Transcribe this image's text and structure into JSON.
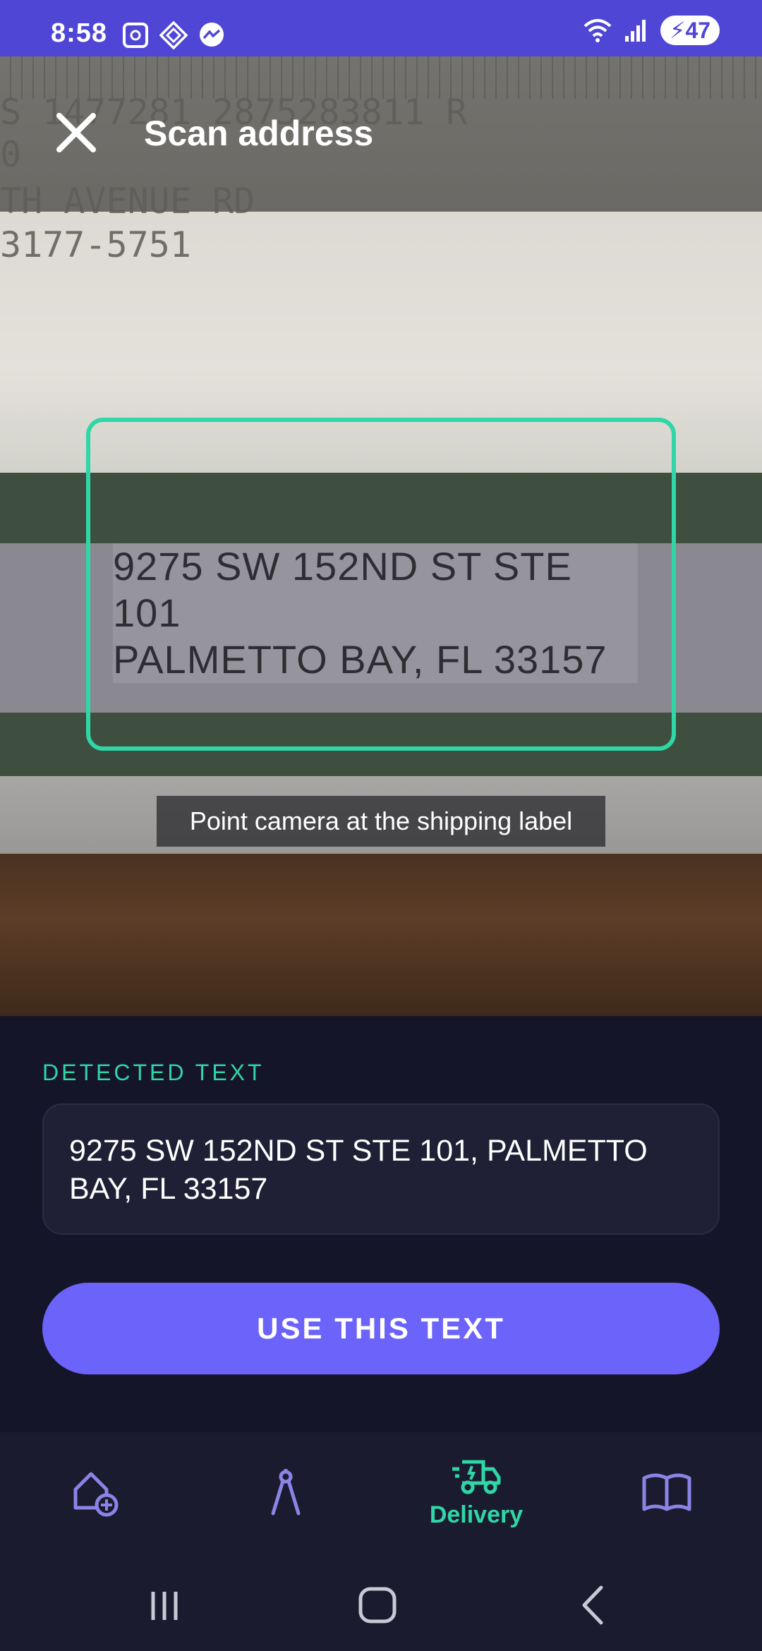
{
  "status_bar": {
    "time": "8:58",
    "battery": "47",
    "left_icons": [
      "screenshot-icon",
      "app-icon",
      "messenger-icon"
    ],
    "right_icons": [
      "wifi-icon",
      "signal-icon",
      "battery-icon"
    ]
  },
  "app_bar": {
    "title": "Scan address",
    "close_icon": "close-icon"
  },
  "camera": {
    "background_text": {
      "line1": "S 1477281  2875283811 R",
      "line2": "0",
      "line3": "TH AVENUE RD",
      "line4": "3177-5751"
    },
    "label_line1": "9275 SW 152ND ST STE 101",
    "label_line2": "PALMETTO BAY, FL 33157",
    "hint": "Point camera at the shipping label"
  },
  "sheet": {
    "detected_label": "DETECTED TEXT",
    "detected_value": "9275 SW 152ND ST STE 101, PALMETTO BAY, FL 33157",
    "use_button": "USE THIS TEXT"
  },
  "bottom_nav": {
    "items": [
      {
        "icon": "home-add-icon",
        "label": ""
      },
      {
        "icon": "compass-icon",
        "label": ""
      },
      {
        "icon": "delivery-truck-icon",
        "label": "Delivery",
        "active": true
      },
      {
        "icon": "book-icon",
        "label": ""
      }
    ]
  },
  "colors": {
    "status_bar": "#5046d6",
    "accent_teal": "#2fd6a6",
    "primary_button": "#6b63fa",
    "nav_inactive": "#8a84e6",
    "sheet_bg": "#16162a"
  },
  "system_nav": [
    "recents-icon",
    "home-icon",
    "back-icon"
  ]
}
